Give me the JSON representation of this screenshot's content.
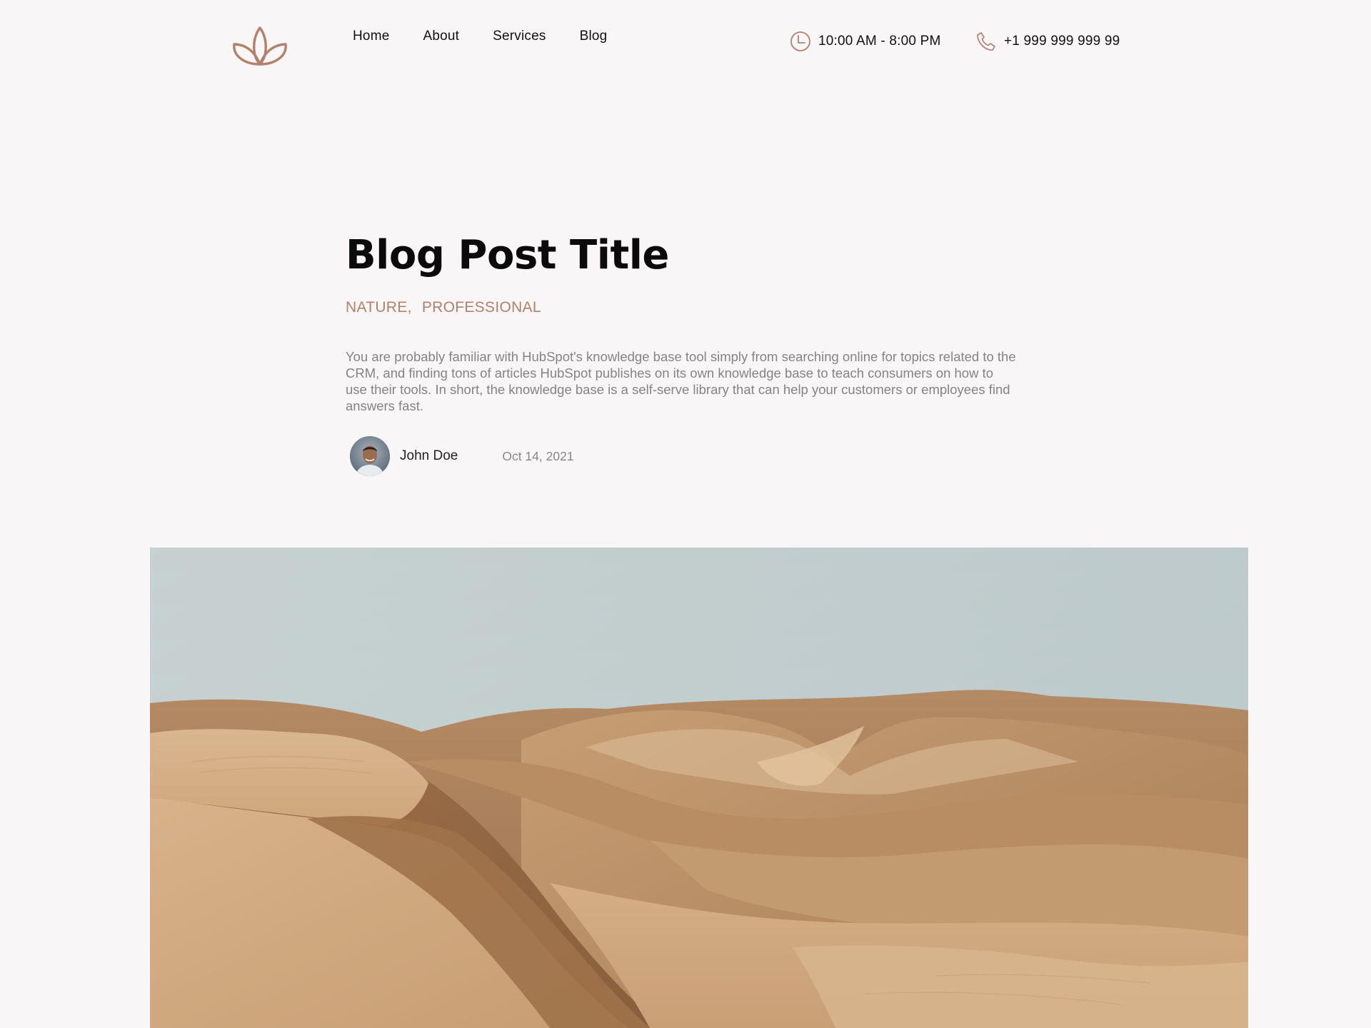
{
  "header": {
    "logo_icon": "lotus-logo-icon",
    "nav": [
      {
        "label": "Home"
      },
      {
        "label": "About"
      },
      {
        "label": "Services"
      },
      {
        "label": "Blog"
      }
    ],
    "hours": {
      "icon": "clock-icon",
      "text": "10:00 AM - 8:00 PM"
    },
    "phone": {
      "icon": "phone-icon",
      "text": "+1 999 999 999 99"
    }
  },
  "article": {
    "title": "Blog Post Title",
    "categories": [
      "NATURE,",
      "PROFESSIONAL"
    ],
    "excerpt": "You are probably familiar with HubSpot's knowledge base tool simply from searching online for topics related to the CRM, and finding tons of articles HubSpot publishes on its own knowledge base to teach consumers on how to use their tools. In short, the knowledge base is a self-serve library that can help your customers or employees find answers fast.",
    "author": "John Doe",
    "date": "Oct 14, 2021"
  },
  "colors": {
    "background": "#f8f6f6",
    "accent": "#b3816b",
    "text": "#111111",
    "muted": "#848484"
  }
}
